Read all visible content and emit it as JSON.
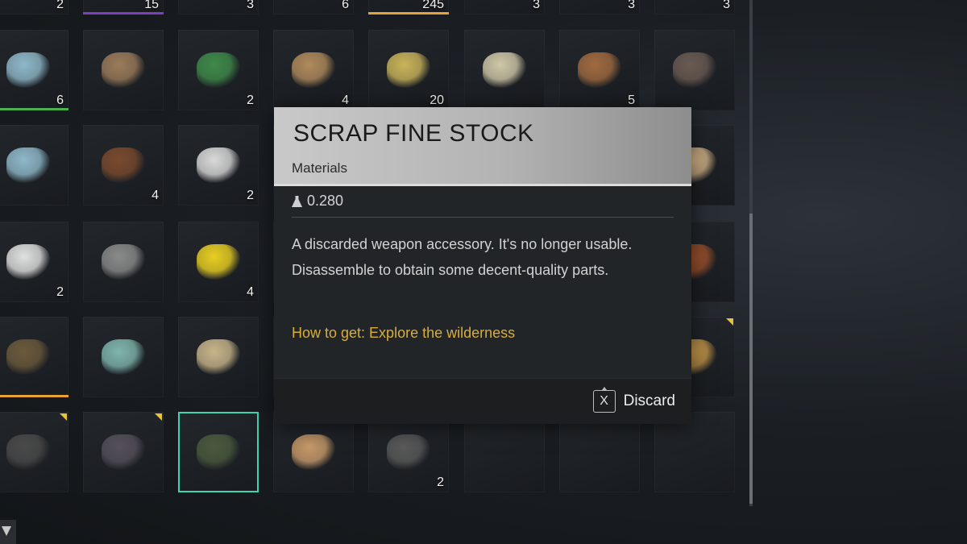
{
  "colors": {
    "selected_outline": "#3fd3b2",
    "howto_text": "#d9ad3c",
    "flag": "#e9c23b",
    "bar_green": "#4caf50",
    "bar_purple": "#7b3fbf",
    "bar_orange": "#e7a23a"
  },
  "inventory": {
    "rows": [
      [
        {
          "icon": "item-icon",
          "qty": "2"
        },
        {
          "icon": "item-icon",
          "qty": "15",
          "bar": "purple"
        },
        {
          "icon": "item-icon",
          "qty": "3"
        },
        {
          "icon": "item-icon",
          "qty": "6"
        },
        {
          "icon": "item-icon",
          "qty": "245",
          "bar": "orange"
        },
        {
          "icon": "item-icon",
          "qty": "3"
        },
        {
          "icon": "item-icon",
          "qty": "3"
        },
        {
          "icon": "item-icon",
          "qty": "3"
        }
      ],
      [
        {
          "icon": "syringe-icon",
          "qty": "6",
          "bar": "green"
        },
        {
          "icon": "sack-icon",
          "qty": ""
        },
        {
          "icon": "pliers-icon",
          "qty": "2"
        },
        {
          "icon": "leather-icon",
          "qty": "4"
        },
        {
          "icon": "ore-icon",
          "qty": "20"
        },
        {
          "icon": "cloth-icon",
          "qty": ""
        },
        {
          "icon": "wood-plank-icon",
          "qty": "5"
        },
        {
          "icon": "hammer-icon",
          "qty": ""
        }
      ],
      [
        {
          "icon": "syringe-icon",
          "qty": ""
        },
        {
          "icon": "photo-frame-icon",
          "qty": "4"
        },
        {
          "icon": "phone-icon",
          "qty": "2"
        },
        {
          "icon": "hidden-icon",
          "qty": ""
        },
        {
          "icon": "hidden-icon",
          "qty": ""
        },
        {
          "icon": "hidden-icon",
          "qty": ""
        },
        {
          "icon": "hidden-icon",
          "qty": ""
        },
        {
          "icon": "paper-icon",
          "qty": ""
        }
      ],
      [
        {
          "icon": "bag-icon",
          "qty": "2"
        },
        {
          "icon": "whisk-icon",
          "qty": ""
        },
        {
          "icon": "tag-icon",
          "qty": "4"
        },
        {
          "icon": "hidden-icon",
          "qty": ""
        },
        {
          "icon": "hidden-icon",
          "qty": ""
        },
        {
          "icon": "hidden-icon",
          "qty": ""
        },
        {
          "icon": "hidden-icon",
          "qty": ""
        },
        {
          "icon": "ball-icon",
          "qty": ""
        }
      ],
      [
        {
          "icon": "rifle-icon",
          "qty": "",
          "bar": "orange"
        },
        {
          "icon": "lion-statue-icon",
          "qty": ""
        },
        {
          "icon": "rope-icon",
          "qty": ""
        },
        {
          "icon": "hidden-icon",
          "qty": ""
        },
        {
          "icon": "hidden-icon",
          "qty": ""
        },
        {
          "icon": "hidden-icon",
          "qty": ""
        },
        {
          "icon": "hidden-icon",
          "qty": ""
        },
        {
          "icon": "tape-icon",
          "qty": "",
          "flag": true
        }
      ],
      [
        {
          "icon": "tire-icon",
          "qty": "",
          "flag": true
        },
        {
          "icon": "camera-icon",
          "qty": "",
          "flag": true
        },
        {
          "icon": "gun-stock-icon",
          "qty": "",
          "selected": true
        },
        {
          "icon": "gloves-icon",
          "qty": ""
        },
        {
          "icon": "case-icon",
          "qty": "2"
        },
        {
          "icon": "empty",
          "qty": ""
        },
        {
          "icon": "empty",
          "qty": ""
        },
        {
          "icon": "empty",
          "qty": ""
        }
      ]
    ]
  },
  "tooltip": {
    "title": "SCRAP FINE STOCK",
    "category": "Materials",
    "weight": "0.280",
    "description": "A discarded weapon accessory. It's no longer usable. Disassemble to obtain some decent-quality parts.",
    "how_to_get": "How to get: Explore the wilderness",
    "discard_key": "X",
    "discard_label": "Discard"
  }
}
